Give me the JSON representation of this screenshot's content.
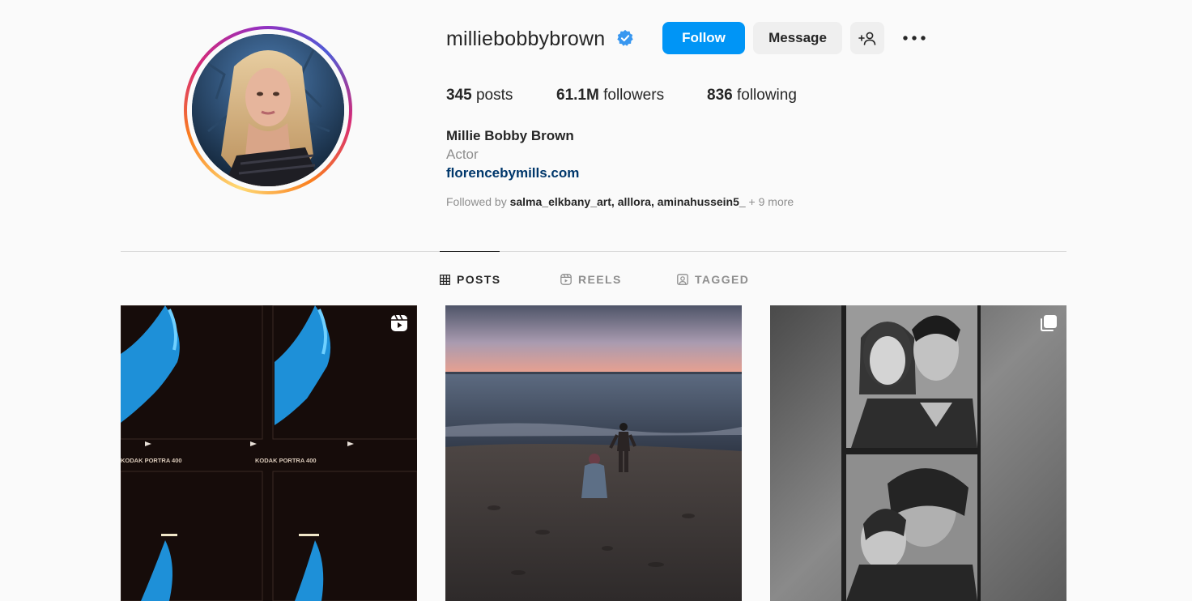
{
  "profile": {
    "username": "milliebobbybrown",
    "verified": true,
    "full_name": "Millie Bobby Brown",
    "category": "Actor",
    "website": "florencebymills.com"
  },
  "actions": {
    "follow_label": "Follow",
    "message_label": "Message",
    "add_user_icon": "add-user-icon",
    "more_icon": "more-options-icon"
  },
  "stats": {
    "posts_count": "345",
    "posts_label": "posts",
    "followers_count": "61.1M",
    "followers_label": "followers",
    "following_count": "836",
    "following_label": "following"
  },
  "followed_by": {
    "prefix": "Followed by",
    "accounts": [
      "salma_elkbany_art",
      "alllora",
      "aminahussein5_"
    ],
    "more": "+ 9 more"
  },
  "tabs": [
    {
      "label": "POSTS",
      "icon": "grid-icon",
      "active": true
    },
    {
      "label": "REELS",
      "icon": "reels-icon",
      "active": false
    },
    {
      "label": "TAGGED",
      "icon": "tagged-icon",
      "active": false
    }
  ],
  "posts": [
    {
      "type": "reel",
      "badge_icon": "reel-badge-icon",
      "film_text": "KODAK PORTRA 400"
    },
    {
      "type": "photo"
    },
    {
      "type": "carousel",
      "badge_icon": "carousel-badge-icon"
    }
  ],
  "colors": {
    "primary_button": "#0095f6",
    "secondary_button": "#efefef",
    "link": "#00376b",
    "verified_badge": "#3897f0"
  }
}
